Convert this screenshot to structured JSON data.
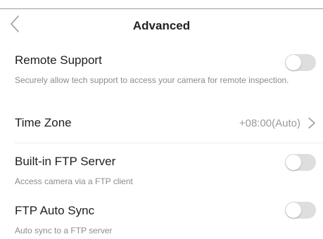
{
  "header": {
    "title": "Advanced",
    "back_icon": "chevron-left-icon"
  },
  "settings": [
    {
      "title": "Remote Support",
      "description": "Securely allow tech support to access your camera for remote inspection.",
      "control": "toggle",
      "enabled": false
    },
    {
      "title": "Time Zone",
      "value": "+08:00(Auto)",
      "control": "chevron-right-icon"
    },
    {
      "title": "Built-in FTP Server",
      "description": "Access camera via a FTP client",
      "control": "toggle",
      "enabled": false
    },
    {
      "title": "FTP Auto Sync",
      "description": "Auto sync to a FTP server",
      "control": "toggle",
      "enabled": false
    }
  ],
  "colors": {
    "toggle_off_track": "#dedede",
    "secondary_text": "#8c8c8c",
    "value_text": "#9a9a9a"
  }
}
